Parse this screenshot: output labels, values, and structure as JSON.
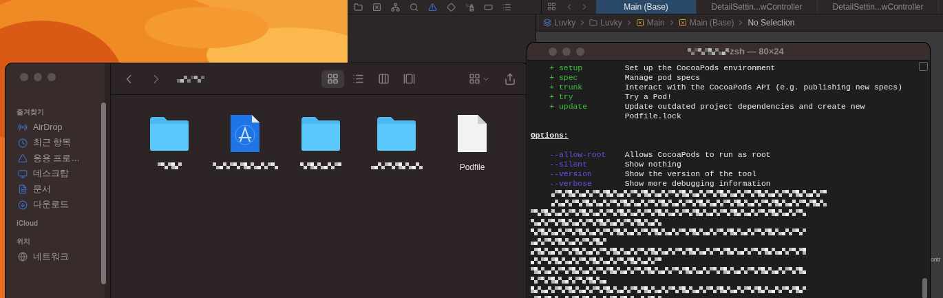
{
  "xcode": {
    "tabs": [
      {
        "label": "Main (Base)",
        "selected": true
      },
      {
        "label": "DetailSettin...wController",
        "selected": false
      },
      {
        "label": "DetailSettin...wController",
        "selected": false
      }
    ],
    "breadcrumb": [
      {
        "label": "Luvky",
        "kind": "app"
      },
      {
        "label": "Luvky",
        "kind": "folder"
      },
      {
        "label": "Main",
        "kind": "storyboard"
      },
      {
        "label": "Main (Base)",
        "kind": "storyboard"
      },
      {
        "label": "No Selection",
        "kind": "plain"
      }
    ],
    "canvas_text": "ontr"
  },
  "finder": {
    "sidebar": [
      {
        "heading": "즐겨찾기",
        "items": [
          {
            "label": "AirDrop"
          },
          {
            "label": "최근 항목"
          },
          {
            "label": "응용 프로…"
          },
          {
            "label": "데스크탑"
          },
          {
            "label": "문서"
          },
          {
            "label": "다운로드"
          }
        ]
      },
      {
        "heading": "iCloud"
      },
      {
        "heading": "위치",
        "items": [
          {
            "label": "네트워크"
          }
        ]
      }
    ],
    "views": [
      {
        "kind": "icons",
        "selected": true
      },
      {
        "kind": "list",
        "selected": false
      },
      {
        "kind": "columns",
        "selected": false
      },
      {
        "kind": "gallery",
        "selected": false
      }
    ],
    "files": [
      {
        "kind": "folder"
      },
      {
        "kind": "project"
      },
      {
        "kind": "folder"
      },
      {
        "kind": "folder"
      },
      {
        "kind": "document",
        "name": "Podfile"
      }
    ]
  },
  "terminal": {
    "title": "-zsh — 80×24",
    "lines": [
      {
        "kind": "command",
        "name": "+ setup",
        "text": "Set up the CocoaPods environment"
      },
      {
        "kind": "command",
        "name": "+ spec",
        "text": "Manage pod specs"
      },
      {
        "kind": "command",
        "name": "+ trunk",
        "text": "Interact with the CocoaPods API (e.g. publishing new specs)"
      },
      {
        "kind": "command",
        "name": "+ try",
        "text": "Try a Pod!"
      },
      {
        "kind": "command",
        "name": "+ update",
        "text": "Update outdated project dependencies and create new"
      },
      {
        "kind": "command",
        "text": "Podfile.lock"
      },
      {
        "kind": "blank"
      },
      {
        "kind": "heading",
        "text": "Options:"
      },
      {
        "kind": "blank"
      },
      {
        "kind": "option",
        "name": "--allow-root",
        "text": "Allows CocoaPods to run as root"
      },
      {
        "kind": "option",
        "name": "--silent",
        "text": "Show nothing"
      },
      {
        "kind": "option",
        "name": "--version",
        "text": "Show the version of the tool"
      },
      {
        "kind": "option",
        "name": "--verbose",
        "text": "Show more debugging information"
      }
    ]
  }
}
